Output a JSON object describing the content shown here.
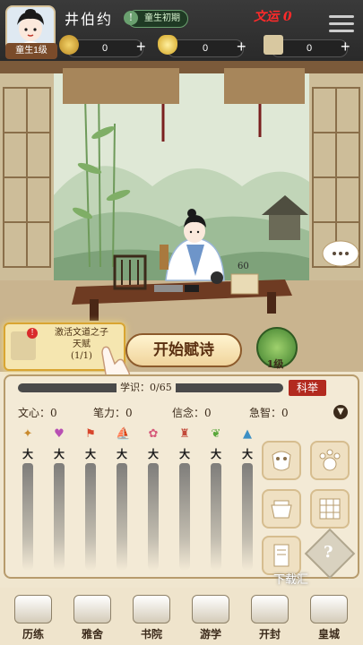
{
  "header": {
    "avatar_rank": "童生1级",
    "player_name": "井伯约",
    "stage_label": "童生初期",
    "wenyun_label": "文运 0",
    "resources": [
      {
        "icon": "copper-coin-icon",
        "value": "0"
      },
      {
        "icon": "gold-ingot-icon",
        "value": "0"
      },
      {
        "icon": "scroll-ticket-icon",
        "value": "0"
      }
    ]
  },
  "scene": {
    "progress_number": "60"
  },
  "event": {
    "title_line1": "激活文道之子",
    "title_line2": "天赋",
    "count": "(1/1)"
  },
  "start_button": "开始赋诗",
  "level_badge": "1级",
  "progress": {
    "label": "学识：0/65",
    "exam_button": "科举",
    "fill": 0
  },
  "stats": [
    {
      "label": "文心：0"
    },
    {
      "label": "笔力：0"
    },
    {
      "label": "信念：0"
    },
    {
      "label": "急智：0"
    }
  ],
  "ink_columns": [
    {
      "icon": "wheat-icon",
      "char": "大",
      "color": "#c98a2d"
    },
    {
      "icon": "heart-icon",
      "char": "大",
      "color": "#b84fb3"
    },
    {
      "icon": "flag-icon",
      "char": "大",
      "color": "#d8462c"
    },
    {
      "icon": "sailboat-icon",
      "char": "大",
      "color": "#d9a21b"
    },
    {
      "icon": "lotus-icon",
      "char": "大",
      "color": "#d65a7a"
    },
    {
      "icon": "tower-icon",
      "char": "大",
      "color": "#c24a3a"
    },
    {
      "icon": "leaf-icon",
      "char": "大",
      "color": "#5aa83b"
    },
    {
      "icon": "mountain-icon",
      "char": "大",
      "color": "#3c8fc4"
    }
  ],
  "watermark": "下载汇",
  "nav": [
    {
      "label": "历练"
    },
    {
      "label": "雅舍"
    },
    {
      "label": "书院"
    },
    {
      "label": "游学"
    },
    {
      "label": "开封"
    },
    {
      "label": "皇城"
    }
  ]
}
